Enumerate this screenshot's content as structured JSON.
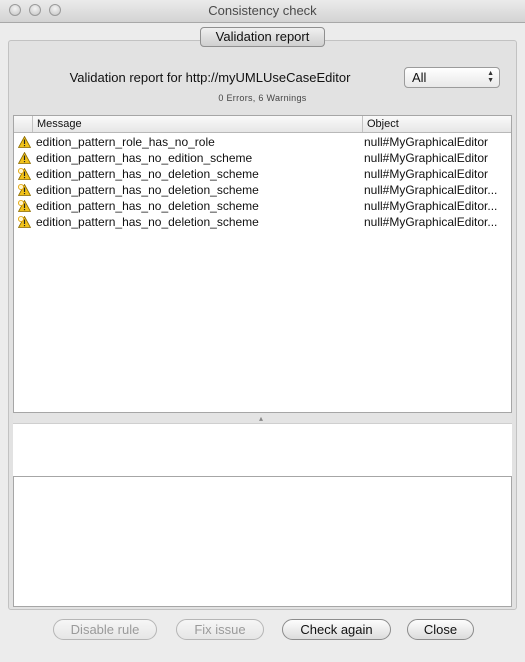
{
  "window": {
    "title": "Consistency check"
  },
  "tabs": [
    {
      "label": "Validation report",
      "selected": true
    }
  ],
  "report": {
    "title": "Validation report for http://myUMLUseCaseEditor",
    "summary": "0 Errors, 6 Warnings"
  },
  "filter": {
    "selected": "All"
  },
  "table": {
    "columns": [
      "Message",
      "Object"
    ],
    "rows": [
      {
        "icon": "warning-icon",
        "message": "edition_pattern_role_has_no_role",
        "object": "null#MyGraphicalEditor"
      },
      {
        "icon": "warning-icon",
        "message": "edition_pattern_has_no_edition_scheme",
        "object": "null#MyGraphicalEditor"
      },
      {
        "icon": "warning-fixable-icon",
        "message": "edition_pattern_has_no_deletion_scheme",
        "object": "null#MyGraphicalEditor"
      },
      {
        "icon": "warning-fixable-icon",
        "message": "edition_pattern_has_no_deletion_scheme",
        "object": "null#MyGraphicalEditor..."
      },
      {
        "icon": "warning-fixable-icon",
        "message": "edition_pattern_has_no_deletion_scheme",
        "object": "null#MyGraphicalEditor..."
      },
      {
        "icon": "warning-fixable-icon",
        "message": "edition_pattern_has_no_deletion_scheme",
        "object": "null#MyGraphicalEditor..."
      }
    ]
  },
  "buttons": {
    "disable_rule": "Disable rule",
    "fix_issue": "Fix issue",
    "check_again": "Check again",
    "close": "Close"
  },
  "colors": {
    "warning": "#f2c21a",
    "fixable_accent": "#e0a000"
  }
}
